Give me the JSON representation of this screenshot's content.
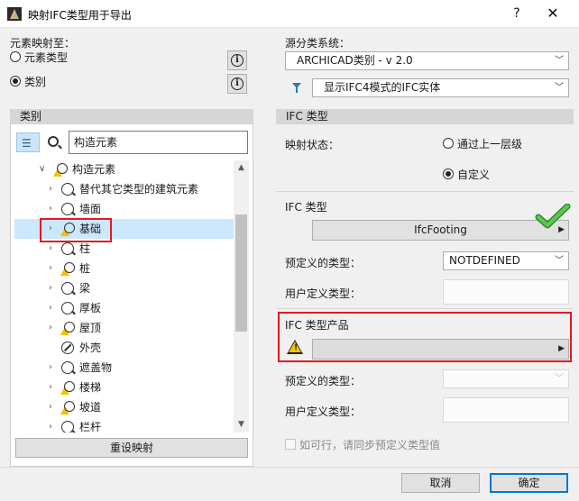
{
  "window": {
    "title": "映射IFC类型用于导出",
    "help": "?",
    "close": "✕"
  },
  "mapping_target": {
    "label": "元素映射至：",
    "options": [
      {
        "label": "元素类型",
        "checked": false
      },
      {
        "label": "类别",
        "checked": true
      }
    ]
  },
  "source": {
    "label": "源分类系统：",
    "system_value": "ARCHICAD类别 - v 2.0",
    "filter_value": "显示IFC4模式的IFC实体",
    "filter_icon": "filter-icon"
  },
  "left_panel": {
    "header": "类别",
    "search_value": "构造元素",
    "tree": [
      {
        "label": "构造元素",
        "expanded": true,
        "icon": "warn"
      },
      {
        "label": "替代其它类型的建筑元素",
        "icon": "search"
      },
      {
        "label": "墙面",
        "icon": "search"
      },
      {
        "label": "基础",
        "icon": "warn",
        "selected": true
      },
      {
        "label": "柱",
        "icon": "search"
      },
      {
        "label": "桩",
        "icon": "warn"
      },
      {
        "label": "梁",
        "icon": "search"
      },
      {
        "label": "厚板",
        "icon": "search"
      },
      {
        "label": "屋顶",
        "icon": "warn"
      },
      {
        "label": "外壳",
        "icon": "hollow",
        "no_chevron": true
      },
      {
        "label": "遮盖物",
        "icon": "search"
      },
      {
        "label": "楼梯",
        "icon": "warn"
      },
      {
        "label": "坡道",
        "icon": "warn"
      },
      {
        "label": "栏杆",
        "icon": "search"
      }
    ],
    "reset_button": "重设映射"
  },
  "right_panel": {
    "header": "IFC 类型",
    "mapping_status_label": "映射状态：",
    "status_options": [
      {
        "label": "通过上一层级",
        "checked": false
      },
      {
        "label": "自定义",
        "checked": true
      }
    ],
    "ifc_type": {
      "label": "IFC 类型",
      "value": "IfcFooting",
      "predefined_label": "预定义的类型：",
      "predefined_value": "NOTDEFINED",
      "user_defined_label": "用户定义类型："
    },
    "ifc_product": {
      "label": "IFC 类型产品",
      "value": "",
      "predefined_label": "预定义的类型：",
      "user_defined_label": "用户定义类型：",
      "sync_label": "如可行，请同步预定义类型值"
    }
  },
  "footer": {
    "cancel": "取消",
    "ok": "确定"
  },
  "colors": {
    "highlight_red": "#e3181d",
    "selection": "#cce8ff",
    "check_green": "#3aa531",
    "warning_yellow": "#f5c400"
  }
}
